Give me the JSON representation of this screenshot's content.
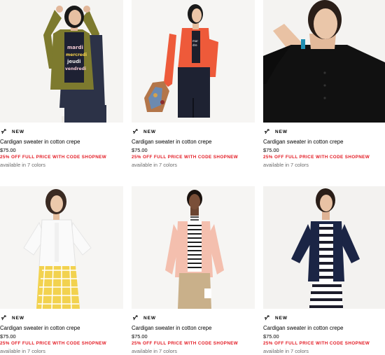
{
  "products": [
    {
      "badge": "NEW",
      "title": "Cardigan sweater in cotton crepe",
      "price": "$75.00",
      "promo": "25% OFF FULL PRICE WITH CODE SHOPNEW",
      "colors": "available in 7 colors",
      "sweater_color": "#7d7a2e"
    },
    {
      "badge": "NEW",
      "title": "Cardigan sweater in cotton crepe",
      "price": "$75.00",
      "promo": "25% OFF FULL PRICE WITH CODE SHOPNEW",
      "colors": "available in 7 colors",
      "sweater_color": "#ee5a3a"
    },
    {
      "badge": "NEW",
      "title": "Cardigan sweater in cotton crepe",
      "price": "$75.00",
      "promo": "25% OFF FULL PRICE WITH CODE SHOPNEW",
      "colors": "available in 7 colors",
      "sweater_color": "#111111"
    },
    {
      "badge": "NEW",
      "title": "Cardigan sweater in cotton crepe",
      "price": "$75.00",
      "promo": "25% OFF FULL PRICE WITH CODE SHOPNEW",
      "colors": "available in 7 colors",
      "sweater_color": "#fafafa"
    },
    {
      "badge": "NEW",
      "title": "Cardigan sweater in cotton crepe",
      "price": "$75.00",
      "promo": "25% OFF FULL PRICE WITH CODE SHOPNEW",
      "colors": "available in 7 colors",
      "sweater_color": "#f4bfae"
    },
    {
      "badge": "NEW",
      "title": "Cardigan sweater in cotton crepe",
      "price": "$75.00",
      "promo": "25% OFF FULL PRICE WITH CODE SHOPNEW",
      "colors": "available in 7 colors",
      "sweater_color": "#1b2545"
    }
  ],
  "badge_icon": "sparkle-icon",
  "promo_color": "#e31a23",
  "tshirt_text": [
    "mardi",
    "mercredi",
    "jeudi",
    "vendredi"
  ]
}
